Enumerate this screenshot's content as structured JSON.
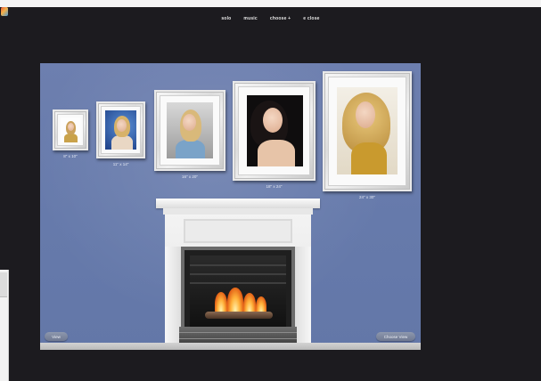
{
  "nav": {
    "items": [
      "solo",
      "music",
      "choose +",
      "e close"
    ]
  },
  "frames": [
    {
      "label": "8\" x 10\""
    },
    {
      "label": "11\" x 14\""
    },
    {
      "label": "16\" x 20\""
    },
    {
      "label": "18\" x 24\""
    },
    {
      "label": "24\" x 30\""
    }
  ],
  "controls": {
    "left_label": "View",
    "right_label": "Choose View"
  },
  "colors": {
    "wall": "#6b7dad",
    "background": "#1c1b1f"
  }
}
